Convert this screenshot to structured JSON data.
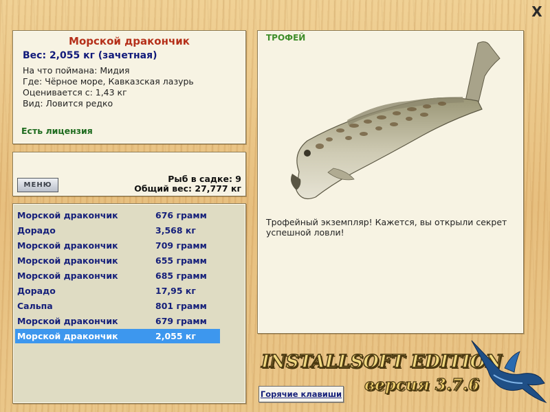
{
  "window": {
    "close_label": "X"
  },
  "info": {
    "title": "Морской дракончик",
    "weight": "Вес: 2,055 кг (зачетная)",
    "lines": [
      "На что поймана: Мидия",
      "Где: Чёрное море, Кавказская лазурь",
      "Оценивается с: 1,43 кг",
      "Вид: Ловится редко"
    ],
    "license": "Есть лицензия"
  },
  "summary": {
    "menu_label": "МЕНЮ",
    "keepnet": "Рыб в садке: 9",
    "total": "Общий вес: 27,777 кг"
  },
  "catch_list": [
    {
      "name": "Морской дракончик",
      "weight": "676 грамм"
    },
    {
      "name": "Дорадо",
      "weight": "3,568 кг"
    },
    {
      "name": "Морской дракончик",
      "weight": "709 грамм"
    },
    {
      "name": "Морской дракончик",
      "weight": "655 грамм"
    },
    {
      "name": "Морской дракончик",
      "weight": "685 грамм"
    },
    {
      "name": "Дорадо",
      "weight": "17,95 кг"
    },
    {
      "name": "Сальпа",
      "weight": "801 грамм"
    },
    {
      "name": "Морской дракончик",
      "weight": "679 грамм"
    },
    {
      "name": "Морской дракончик",
      "weight": "2,055 кг"
    }
  ],
  "selected_index": 8,
  "trophy": {
    "title": "ТРОФЕЙ",
    "description": "Трофейный экземпляр! Кажется, вы открыли секрет успешной ловли!"
  },
  "logo": {
    "title": "INSTALLSOFT EDITION",
    "version": "версия 3.7.6"
  },
  "hotkeys_label": "Горячие клавиши",
  "colors": {
    "selected_row": "#3d97ee",
    "list_text": "#16207a",
    "title_red": "#b5301a",
    "license_green": "#1e6b1e"
  },
  "icons": {
    "close": "close-icon",
    "fish": "fish-image",
    "marlin": "marlin-logo"
  }
}
